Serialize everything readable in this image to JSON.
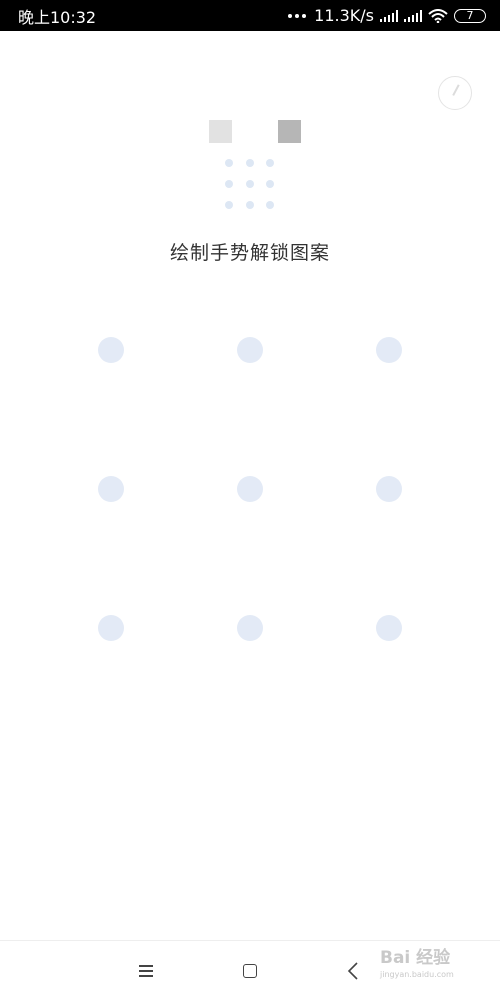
{
  "status_bar": {
    "time": "晚上10:32",
    "network_speed": "11.3K/s",
    "battery_level": "7"
  },
  "lock_setup": {
    "instruction": "绘制手势解锁图案",
    "pattern_grid": {
      "rows": 3,
      "cols": 3
    }
  },
  "nav_bar": {
    "icons": [
      "menu-icon",
      "home-icon",
      "back-icon"
    ]
  },
  "watermark": {
    "brand": "Bai 经验",
    "url": "jingyan.baidu.com"
  },
  "colors": {
    "status_bg": "#000000",
    "node_color": "#e3eaf6",
    "preview_dot": "#dde7f4",
    "text": "#333333"
  }
}
